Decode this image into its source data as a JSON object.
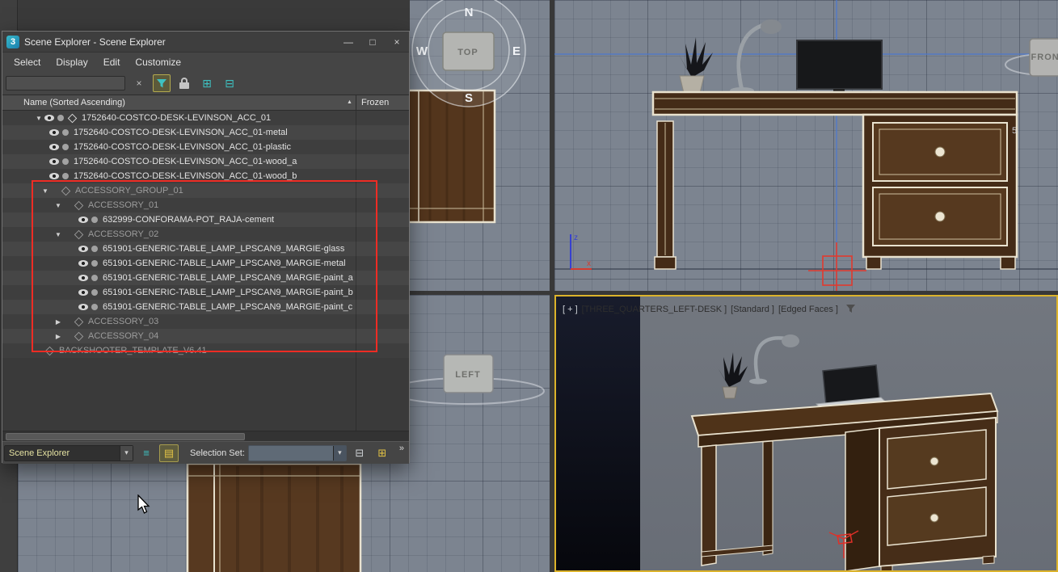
{
  "glyphs": {
    "expanded": "▼",
    "collapsed": "▶",
    "sort_asc": "▲",
    "clear": "×",
    "minimize": "—",
    "maximize": "□",
    "close": "×",
    "dropdown": "▾",
    "chevrons": "»"
  },
  "explorer": {
    "title": "Scene Explorer - Scene Explorer",
    "logo_text": "3",
    "menus": [
      {
        "label": "Select"
      },
      {
        "label": "Display"
      },
      {
        "label": "Edit"
      },
      {
        "label": "Customize"
      }
    ],
    "search": {
      "value": "",
      "placeholder": ""
    },
    "toolbar_icons": {
      "display_children": "⊞",
      "display_dependents": "⊟"
    },
    "columns": {
      "name": "Name (Sorted Ascending)",
      "frozen": "Frozen"
    },
    "tree": {
      "rows": [
        {
          "label": "1752640-COSTCO-DESK-LEVINSON_ACC_01",
          "indent": 38,
          "arrow": "down",
          "eye": true,
          "dot": true,
          "icon": "geom",
          "muted": false
        },
        {
          "label": "1752640-COSTCO-DESK-LEVINSON_ACC_01-metal",
          "indent": 58,
          "arrow": null,
          "eye": true,
          "dot": true,
          "icon": null,
          "muted": false
        },
        {
          "label": "1752640-COSTCO-DESK-LEVINSON_ACC_01-plastic",
          "indent": 58,
          "arrow": null,
          "eye": true,
          "dot": true,
          "icon": null,
          "muted": false
        },
        {
          "label": "1752640-COSTCO-DESK-LEVINSON_ACC_01-wood_a",
          "indent": 58,
          "arrow": null,
          "eye": true,
          "dot": true,
          "icon": null,
          "muted": false
        },
        {
          "label": "1752640-COSTCO-DESK-LEVINSON_ACC_01-wood_b",
          "indent": 58,
          "arrow": null,
          "eye": true,
          "dot": true,
          "icon": null,
          "muted": false
        },
        {
          "label": "ACCESSORY_GROUP_01",
          "indent": 46,
          "arrow": "down",
          "eye": false,
          "dot": false,
          "icon": "group",
          "muted": true
        },
        {
          "label": "ACCESSORY_01",
          "indent": 62,
          "arrow": "down",
          "eye": false,
          "dot": false,
          "icon": "group",
          "muted": true
        },
        {
          "label": "632999-CONFORAMA-POT_RAJA-cement",
          "indent": 94,
          "arrow": null,
          "eye": true,
          "dot": true,
          "icon": null,
          "muted": false
        },
        {
          "label": "ACCESSORY_02",
          "indent": 62,
          "arrow": "down",
          "eye": false,
          "dot": false,
          "icon": "group",
          "muted": true
        },
        {
          "label": "651901-GENERIC-TABLE_LAMP_LPSCAN9_MARGIE-glass",
          "indent": 94,
          "arrow": null,
          "eye": true,
          "dot": true,
          "icon": null,
          "muted": false
        },
        {
          "label": "651901-GENERIC-TABLE_LAMP_LPSCAN9_MARGIE-metal",
          "indent": 94,
          "arrow": null,
          "eye": true,
          "dot": true,
          "icon": null,
          "muted": false
        },
        {
          "label": "651901-GENERIC-TABLE_LAMP_LPSCAN9_MARGIE-paint_a",
          "indent": 94,
          "arrow": null,
          "eye": true,
          "dot": true,
          "icon": null,
          "muted": false
        },
        {
          "label": "651901-GENERIC-TABLE_LAMP_LPSCAN9_MARGIE-paint_b",
          "indent": 94,
          "arrow": null,
          "eye": true,
          "dot": true,
          "icon": null,
          "muted": false
        },
        {
          "label": "651901-GENERIC-TABLE_LAMP_LPSCAN9_MARGIE-paint_c",
          "indent": 94,
          "arrow": null,
          "eye": true,
          "dot": true,
          "icon": null,
          "muted": false
        },
        {
          "label": "ACCESSORY_03",
          "indent": 62,
          "arrow": "right",
          "eye": false,
          "dot": false,
          "icon": "group",
          "muted": true
        },
        {
          "label": "ACCESSORY_04",
          "indent": 62,
          "arrow": "right",
          "eye": false,
          "dot": false,
          "icon": "group",
          "muted": true
        },
        {
          "label": "BACKSHOOTER_TEMPLATE_V6.41",
          "indent": 40,
          "arrow": null,
          "eye": false,
          "dot": false,
          "icon": "group",
          "muted": true
        }
      ]
    },
    "bottom": {
      "explorer_name": "Scene Explorer",
      "selection_set_label": "Selection Set:",
      "selection_set_value": ""
    },
    "bottom_icons": {
      "layers": "≡",
      "pin": "▤",
      "edit_set": "⊟",
      "add_set": "⊞"
    }
  },
  "left_toolbar": {
    "icons": [
      {
        "name": "select-circle-icon",
        "glyph": "○",
        "color": "#e09a3e"
      },
      {
        "name": "pan-move-icon",
        "glyph": "+",
        "color": "#c9ced2"
      },
      {
        "name": "light-icon",
        "glyph": "☼",
        "color": "#e8c63f"
      },
      {
        "name": "grid-window-icon",
        "glyph": "▦",
        "color": "#b9bec2"
      },
      {
        "name": "sheet-icon",
        "glyph": "▤",
        "color": "#e09a3e"
      },
      {
        "name": "pencil-icon",
        "glyph": "✎",
        "color": "#e0b13e"
      },
      {
        "name": "waves-icon",
        "glyph": "≈",
        "color": "#3ec1c1"
      },
      {
        "name": "checker-icon",
        "glyph": "▩",
        "color": "#e09a3e"
      },
      {
        "name": "figure-icon",
        "glyph": "☺",
        "color": "#7fc043"
      },
      {
        "name": "gear-icon",
        "glyph": "⚙",
        "color": "#c9ced2"
      },
      {
        "name": "star-icon",
        "glyph": "*",
        "color": "#e09a3e"
      },
      {
        "name": "monitor-icon",
        "glyph": "▭",
        "color": "#b9bec2"
      },
      {
        "name": "box-solid-icon",
        "glyph": "■",
        "color": "#d8d8d8"
      },
      {
        "name": "list-icon",
        "glyph": "≡",
        "color": "#b9bec2"
      },
      {
        "name": "panel-icon",
        "glyph": "▣",
        "color": "#b9bec2"
      },
      {
        "name": "filter-red-icon",
        "glyph": "▼",
        "color": "#d8534a"
      },
      {
        "name": "filter-teal-icon",
        "glyph": "▼",
        "color": "#3ec1c1"
      },
      {
        "name": "frame-icon",
        "glyph": "□",
        "color": "#d8d8d8"
      }
    ]
  },
  "viewports": {
    "top_left": {
      "cube": "TOP",
      "compass_n": "N",
      "compass_w": "W",
      "compass_e": "E",
      "compass_s": "S"
    },
    "bottom_left": {
      "cube": "LEFT"
    },
    "top_right": {
      "cube": "FRONT",
      "coord": "5",
      "axis_x": "x",
      "axis_z": "z"
    },
    "bottom_right": {
      "seg_plus": "[ + ]",
      "seg_view": "[THREE_QUARTERS_LEFT-DESK ]",
      "seg_renderer": "[Standard ]",
      "seg_shading": "[Edged Faces ]"
    }
  },
  "colors": {
    "accent_teal": "#3ec1c1",
    "highlight_red": "#ee2c24",
    "active_viewport_border": "#dcb32b"
  }
}
